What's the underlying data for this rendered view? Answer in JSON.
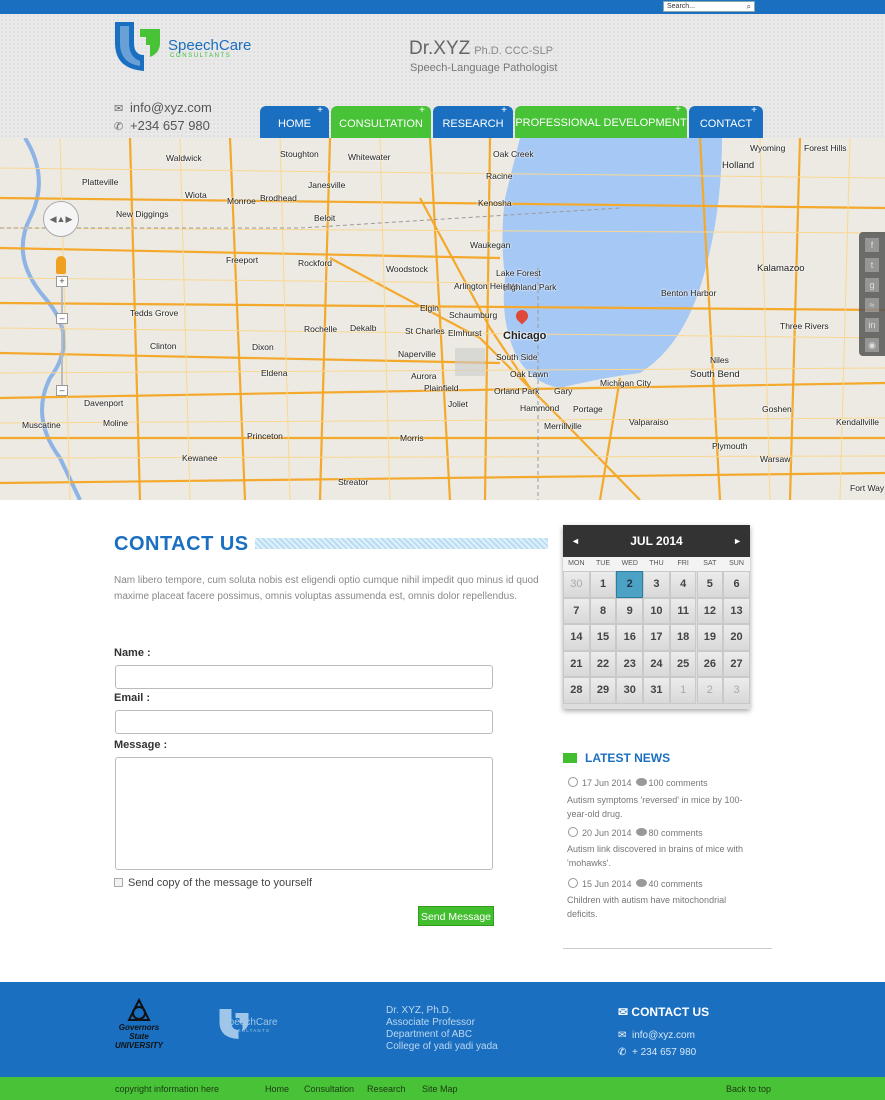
{
  "search": {
    "placeholder": "Search..."
  },
  "logo": {
    "name": "SpeechCare",
    "sub": "CONSULTANTS"
  },
  "doctor": {
    "name": "Dr.XYZ",
    "credentials": "Ph.D. CCC-SLP",
    "title": "Speech-Language Pathologist"
  },
  "contact": {
    "email": "info@xyz.com",
    "phone": "+234 657 980"
  },
  "nav": [
    {
      "label": "HOME"
    },
    {
      "label": "CONSULTATION"
    },
    {
      "label": "RESEARCH"
    },
    {
      "label": "PROFESSIONAL DEVELOPMENT"
    },
    {
      "label": "CONTACT"
    }
  ],
  "map": {
    "labels": [
      "Wyoming",
      "Forest Hills",
      "Waldwick",
      "Stoughton",
      "Whitewater",
      "Oak Creek",
      "Holland",
      "Platteville",
      "Janesville",
      "Racine",
      "Wiota",
      "Monroe",
      "Brodhead",
      "Beloit",
      "Kenosha",
      "New Diggings",
      "Waukegan",
      "Kalamazoo",
      "Freeport",
      "Rockford",
      "Woodstock",
      "Lake Forest",
      "Arlington Heights",
      "Highland Park",
      "Benton Harbor",
      "Tedds Grove",
      "Elgin",
      "Schaumburg",
      "Chicago",
      "Rochelle",
      "Dekalb",
      "St Charles",
      "Elmhurst",
      "Three Rivers",
      "Clinton",
      "Dixon",
      "Naperville",
      "South Side",
      "Niles",
      "Eldena",
      "Oak Lawn",
      "Aurora",
      "Plainfield",
      "Orland Park",
      "Gary",
      "Michigan City",
      "South Bend",
      "Davenport",
      "Joliet",
      "Hammond",
      "Portage",
      "Goshen",
      "Moline",
      "Muscatine",
      "Merrillville",
      "Valparaiso",
      "Kendallville",
      "Princeton",
      "Morris",
      "Plymouth",
      "Kewanee",
      "Warsaw",
      "Streator",
      "Fort Way"
    ]
  },
  "contact_section": {
    "title": "CONTACT US",
    "description": "Nam libero tempore, cum soluta nobis est eligendi optio cumque nihil impedit quo minus id quod maxime placeat facere possimus, omnis voluptas assumenda est, omnis dolor repellendus.",
    "name_label": "Name :",
    "email_label": "Email :",
    "message_label": "Message :",
    "copy_label": "Send copy of the message to yourself",
    "send_label": "Send Message"
  },
  "calendar": {
    "prev": "◄",
    "month": "JUL 2014",
    "next": "►",
    "dows": [
      "MON",
      "TUE",
      "WED",
      "THU",
      "FRI",
      "SAT",
      "SUN"
    ],
    "days": [
      "30",
      "1",
      "2",
      "3",
      "4",
      "5",
      "6",
      "7",
      "8",
      "9",
      "10",
      "11",
      "12",
      "13",
      "14",
      "15",
      "16",
      "17",
      "18",
      "19",
      "20",
      "21",
      "22",
      "23",
      "24",
      "25",
      "26",
      "27",
      "28",
      "29",
      "30",
      "31",
      "1",
      "2",
      "3"
    ]
  },
  "news": {
    "title": "LATEST NEWS",
    "items": [
      {
        "date": "17 Jun 2014",
        "comments": "100 comments",
        "text": "Autism symptoms 'reversed' in mice by 100-year-old drug."
      },
      {
        "date": "20 Jun 2014",
        "comments": "80 comments",
        "text": "Autism link discovered in brains of mice with 'mohawks'."
      },
      {
        "date": "15 Jun 2014",
        "comments": "40 comments",
        "text": "Children with autism have mitochondrial deficits."
      }
    ]
  },
  "footer": {
    "gsu": "Governors State UNIVERSITY",
    "logo_name": "SpeechCare",
    "logo_sub": "CONSULTANTS",
    "addr": [
      "Dr. XYZ, Ph.D.",
      "Associate Professor",
      "Department of ABC",
      "College of yadi yadi yada"
    ],
    "contact_title": "CONTACT US",
    "email": "info@xyz.com",
    "phone": "+ 234 657 980"
  },
  "bottom": {
    "copyright": "copyright information here",
    "links": [
      "Home",
      "Consultation",
      "Research",
      "Site Map"
    ],
    "back": "Back to top"
  },
  "colors": {
    "brand_blue": "#1a6fc0",
    "brand_green": "#48c236"
  }
}
